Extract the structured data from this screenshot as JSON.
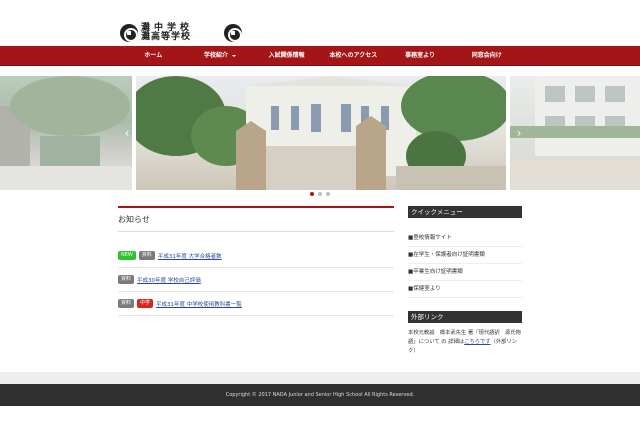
{
  "header": {
    "logo_line1": "灘中学校",
    "logo_line2": "灘高等学校"
  },
  "nav": {
    "items": [
      {
        "label": "ホーム"
      },
      {
        "label": "学校紹介"
      },
      {
        "label": "入試関係情報"
      },
      {
        "label": "本校へのアクセス"
      },
      {
        "label": "事務室より"
      },
      {
        "label": "同窓会向け"
      }
    ]
  },
  "slider": {
    "prev_arrow": "‹",
    "next_arrow": "›",
    "active_index": 0
  },
  "news": {
    "title": "お知らせ",
    "items": [
      {
        "badges": [
          "NEW",
          "資料"
        ],
        "link": "平成31年度 大学合格者数"
      },
      {
        "badges": [
          "資料"
        ],
        "link": "平成30年度 学校自己評価"
      },
      {
        "badges": [
          "資料",
          "中学"
        ],
        "link": "平成31年度 中学校使用教科書一覧"
      }
    ]
  },
  "sidebar": {
    "quick_title": "クイックメニュー",
    "quick_items": [
      "■登校情報サイト",
      "■在学生・保護者向け証明書類",
      "■卒業生向け証明書類",
      "■保健室より"
    ],
    "external_title": "外部リンク",
    "external_text_before": "本校元教諭　橋本武先生 著「現代語訳　源氏物語」について の 詳細は",
    "external_link": "こちらです",
    "external_text_after": "（外部リンク）"
  },
  "footer": {
    "copyright": "Copyright © 2017 NADA Junior and Senior High School All Rights Reserved."
  },
  "colors": {
    "brand_red": "#a41517",
    "new_badge": "#2ec42e",
    "category_badge": "#7a7a7a",
    "junior_badge": "#d9261c"
  }
}
